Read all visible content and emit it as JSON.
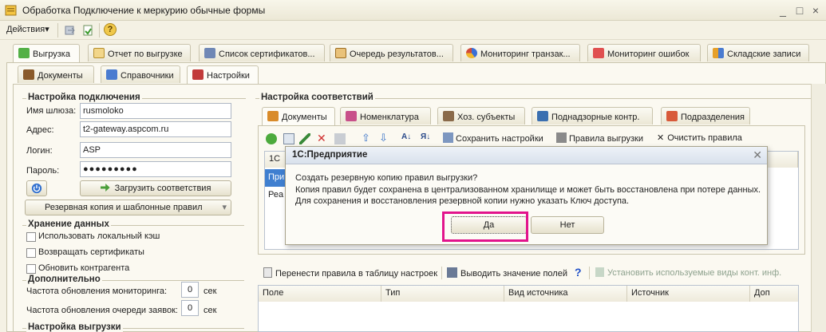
{
  "window": {
    "title": "Обработка  Подключение к меркурию обычные формы",
    "controls": [
      "_",
      "□",
      "×"
    ]
  },
  "toolbar": {
    "actions_label": "Действия",
    "dropdown_arrow": "▾",
    "help": "?"
  },
  "top_tabs": [
    {
      "label": "Выгрузка",
      "icon": "upload-icon",
      "active": true
    },
    {
      "label": "Отчет по выгрузке",
      "icon": "report-icon"
    },
    {
      "label": "Список сертификатов...",
      "icon": "certificate-list-icon"
    },
    {
      "label": "Очередь результатов...",
      "icon": "queue-icon"
    },
    {
      "label": "Мониторинг транзак...",
      "icon": "monitor-icon"
    },
    {
      "label": "Мониторинг ошибок",
      "icon": "error-monitor-icon"
    },
    {
      "label": "Складские записи",
      "icon": "warehouse-icon"
    }
  ],
  "sub_tabs": [
    {
      "label": "Документы",
      "icon": "documents-icon"
    },
    {
      "label": "Справочники",
      "icon": "reference-icon"
    },
    {
      "label": "Настройки",
      "icon": "settings-icon",
      "active": true
    }
  ],
  "connection": {
    "title": "Настройка подключения",
    "gateway_label": "Имя шлюза:",
    "gateway_value": "rusmoloko",
    "address_label": "Адрес:",
    "address_value": "t2-gateway.aspcom.ru",
    "login_label": "Логин:",
    "login_value": "ASP",
    "password_label": "Пароль:",
    "password_value": "●●●●●●●●●",
    "load_button": "Загрузить соответствия",
    "backup_button": "Резервная копия и шаблонные правил"
  },
  "storage": {
    "title": "Хранение данных",
    "options": [
      "Использовать локальный кэш",
      "Возвращать сертификаты",
      "Обновить контрагента"
    ]
  },
  "additional": {
    "title": "Дополнительно",
    "monitoring_label": "Частота обновления мониторинга:",
    "monitoring_value": "0",
    "monitoring_unit": "сек",
    "queue_label": "Частота обновления очереди заявок:",
    "queue_value": "0",
    "queue_unit": "сек"
  },
  "upload_settings": {
    "title": "Настройка выгрузки"
  },
  "mapping": {
    "title": "Настройка соответствий",
    "tabs": [
      {
        "label": "Документы",
        "icon": "documents-icon",
        "active": true
      },
      {
        "label": "Номенклатура",
        "icon": "nomenclature-icon"
      },
      {
        "label": "Хоз. субъекты",
        "icon": "subjects-icon"
      },
      {
        "label": "Поднадзорные контр.",
        "icon": "supervised-icon"
      },
      {
        "label": "Подразделения",
        "icon": "divisions-icon"
      }
    ],
    "toolbar": {
      "save_settings": "Сохранить настройки",
      "upload_rules": "Правила выгрузки",
      "clear_rules": "Очистить правила"
    },
    "grid_col": "1С",
    "grid_rows": [
      "При",
      "Реа"
    ]
  },
  "bottom_toolbar": {
    "move_rules": "Перенести правила в таблицу настроек",
    "show_value": "Выводить значение полей",
    "set_types": "Установить используемые виды конт. инф."
  },
  "bottom_table": {
    "columns": [
      "Поле",
      "Тип",
      "Вид источника",
      "Источник",
      "Доп"
    ]
  },
  "dialog": {
    "title": "1С:Предприятие",
    "line1": "Создать резервную копию правил выгрузки?",
    "line2": "Копия правил будет сохранена в централизованном хранилище и может быть восстановлена при потере данных.",
    "line3": "Для сохранения и восстановления резервной копии нужно указать Ключ доступа.",
    "yes": "Да",
    "no": "Нет"
  },
  "colors": {
    "highlight": "#e2148c",
    "active_tab": "#fdfcf7",
    "window_bg": "#f4f1e4"
  }
}
